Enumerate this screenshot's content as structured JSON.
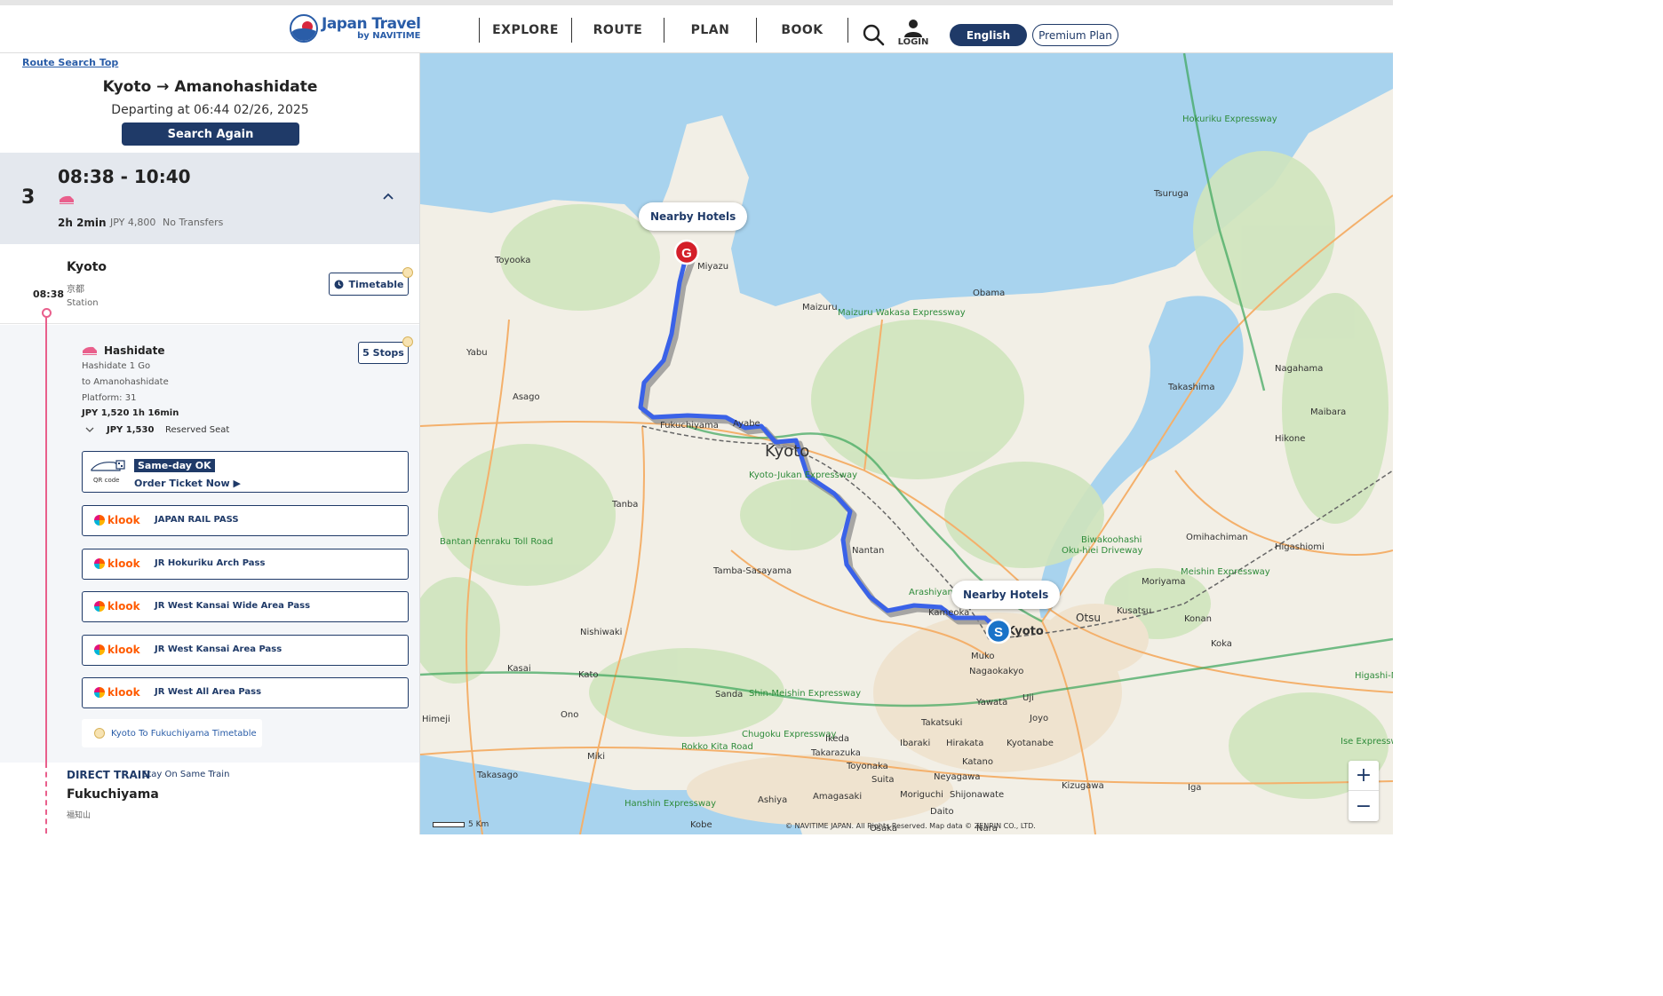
{
  "header": {
    "logo_title": "Japan Travel",
    "logo_sub": "by NAVITIME",
    "nav": [
      "EXPLORE",
      "ROUTE",
      "PLAN",
      "BOOK"
    ],
    "login_label": "LOGIN",
    "lang_label": "English",
    "premium_label": "Premium Plan"
  },
  "sidebar": {
    "top_link": "Route Search Top",
    "route_title": "Kyoto → Amanohashidate",
    "departing": "Departing at 06:44 02/26, 2025",
    "search_again": "Search Again",
    "summary": {
      "index": "3",
      "time_range": "08:38 - 10:40",
      "duration": "2h 2min",
      "fare": "JPY 4,800",
      "transfers": "No Transfers"
    },
    "origin": {
      "name": "Kyoto",
      "name_jp": "京都",
      "type": "Station",
      "time": "08:38",
      "timetable_label": "Timetable"
    },
    "train": {
      "name": "Hashidate",
      "service": "Hashidate 1 Go",
      "direction": "to Amanohashidate",
      "platform": "Platform: 31",
      "fare_duration": "JPY 1,520   1h 16min",
      "seat_fare": "JPY 1,530",
      "seat_type": "Reserved Seat",
      "stops_label": "5 Stops"
    },
    "ticket_card": {
      "qr_label": "QR code",
      "sameday": "Same-day OK",
      "order": "Order Ticket Now ▶"
    },
    "klook_brand": "klook",
    "passes": [
      "JAPAN RAIL PASS",
      "JR Hokuriku Arch Pass",
      "JR West Kansai Wide Area Pass",
      "JR West Kansai Area Pass",
      "JR West All Area Pass"
    ],
    "fukuchiyama_timetable": "Kyoto To Fukuchiyama Timetable",
    "direct": {
      "label": "DIRECT TRAIN",
      "sub": "Stay On Same Train",
      "station": "Fukuchiyama",
      "station_jp": "福知山"
    }
  },
  "map": {
    "hotels_label": "Nearby Hotels",
    "start_marker": "S",
    "goal_marker": "G",
    "labels": [
      "Toyooka",
      "Miyazu",
      "Maizuru",
      "Maizuru Wakasa Expressway",
      "Obama",
      "Tsuruga",
      "Hokuriku Expressway",
      "Yabu",
      "Asago",
      "Fukuchiyama",
      "Ayabe",
      "Kyoto",
      "Kyoto-Jukan Expressway",
      "Takashima",
      "Nagahama",
      "Maibara",
      "Hikone",
      "Tanba",
      "Nantan",
      "Tamba-Sasayama",
      "Bantan Renraku Toll Road",
      "Arashiyama Parkway",
      "Kameoka",
      "Kyoto",
      "Otsu",
      "Kusatsu",
      "Konan",
      "Koka",
      "Oku-hiei Driveway",
      "Biwakoohashi",
      "Omihachiman",
      "Higashiomi",
      "Moriyama",
      "Meishin Expressway",
      "Nishiwaki",
      "Kasai",
      "Kato",
      "Sanda",
      "Ono",
      "Shin-Meishin Expressway",
      "Chugoku Expressway",
      "Rokko Kita Road",
      "Ikeda",
      "Takarazuka",
      "Toyonaka",
      "Suita",
      "Ibaraki",
      "Takatsuki",
      "Hirakata",
      "Katano",
      "Kyotanabe",
      "Nagaokakyo",
      "Muko",
      "Uji",
      "Yawata",
      "Joyo",
      "Nara",
      "Osaka",
      "Amagasaki",
      "Ashiya",
      "Kobe",
      "Himeji",
      "Takasago",
      "Miki",
      "Hanshin Expressway",
      "Kizugawa",
      "Neyagawa",
      "Moriguchi",
      "Shijonawate",
      "Daito",
      "Iga",
      "Ise Expressway",
      "Higashi-Meishin Expressway"
    ],
    "scale": "5 Km",
    "copyright": "© NAVITIME JAPAN. All Rights Reserved. Map data © ZENRIN CO., LTD."
  },
  "colors": {
    "navy": "#1f3a68",
    "route": "#3a62e8",
    "line_pink": "#e95f8c",
    "goal_red": "#d41f2a",
    "start_blue": "#1a73c8"
  }
}
